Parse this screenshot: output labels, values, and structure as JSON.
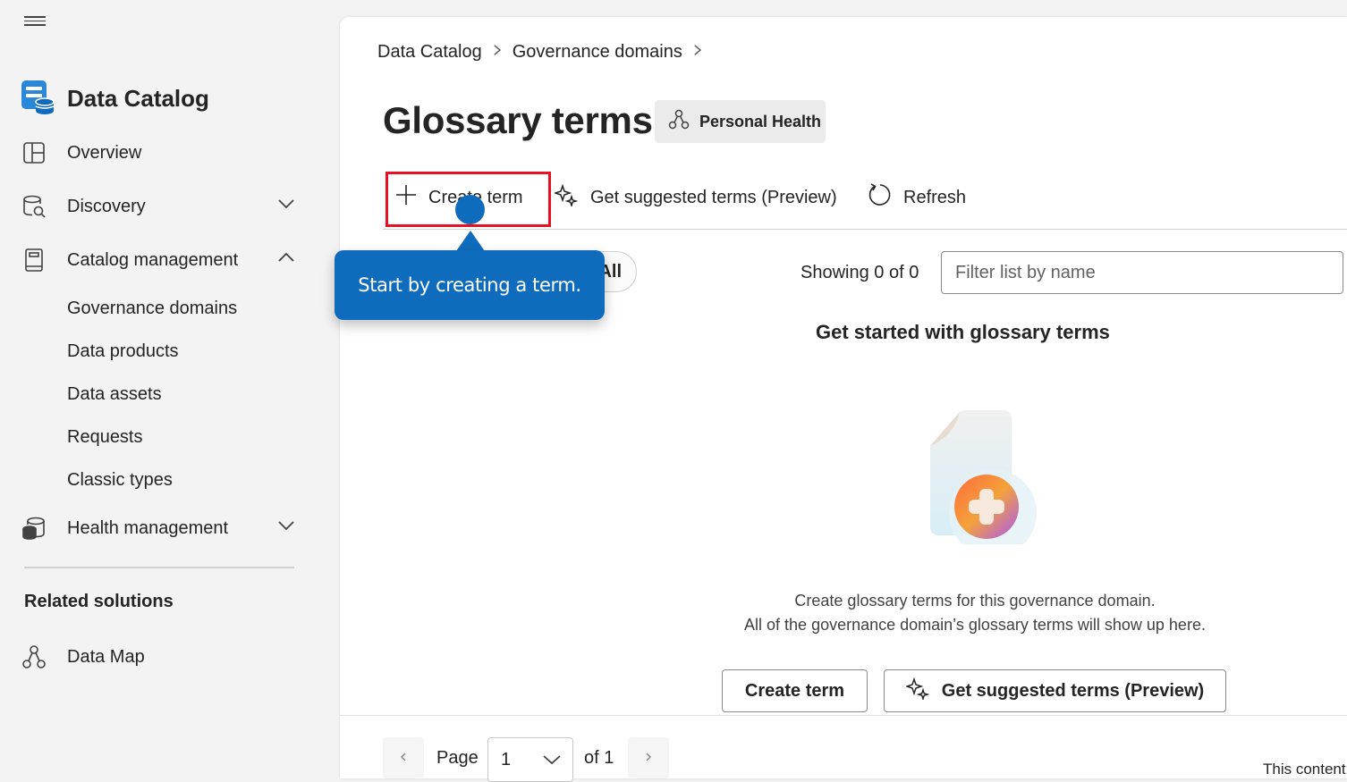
{
  "sidebar": {
    "app_title": "Data Catalog",
    "nav": {
      "overview": "Overview",
      "discovery": "Discovery",
      "catalog_management": "Catalog management",
      "health_management": "Health management"
    },
    "catalog_sub": [
      "Governance domains",
      "Data products",
      "Data assets",
      "Requests",
      "Classic types"
    ],
    "related_title": "Related solutions",
    "related": {
      "data_map": "Data Map"
    }
  },
  "main": {
    "breadcrumb": [
      "Data Catalog",
      "Governance domains"
    ],
    "title": "Glossary terms",
    "domain_badge": "Personal Health",
    "toolbar": {
      "create": "Create term",
      "suggest": "Get suggested terms (Preview)",
      "refresh": "Refresh"
    },
    "filter": {
      "all_pill": "All",
      "showing": "Showing 0 of 0",
      "placeholder": "Filter list by name"
    },
    "empty": {
      "title": "Get started with glossary terms",
      "line1": "Create glossary terms for this governance domain.",
      "line2": "All of the governance domain’s glossary terms will show up here.",
      "create_button": "Create term",
      "suggest_button": "Get suggested terms (Preview)"
    },
    "pager": {
      "page_label": "Page",
      "page_value": "1",
      "of_label": "of 1"
    },
    "footer_note": "This content"
  },
  "coachmark": {
    "text": "Start by creating a term."
  },
  "colors": {
    "accent": "#0f6cbd",
    "highlight": "#e81123"
  }
}
